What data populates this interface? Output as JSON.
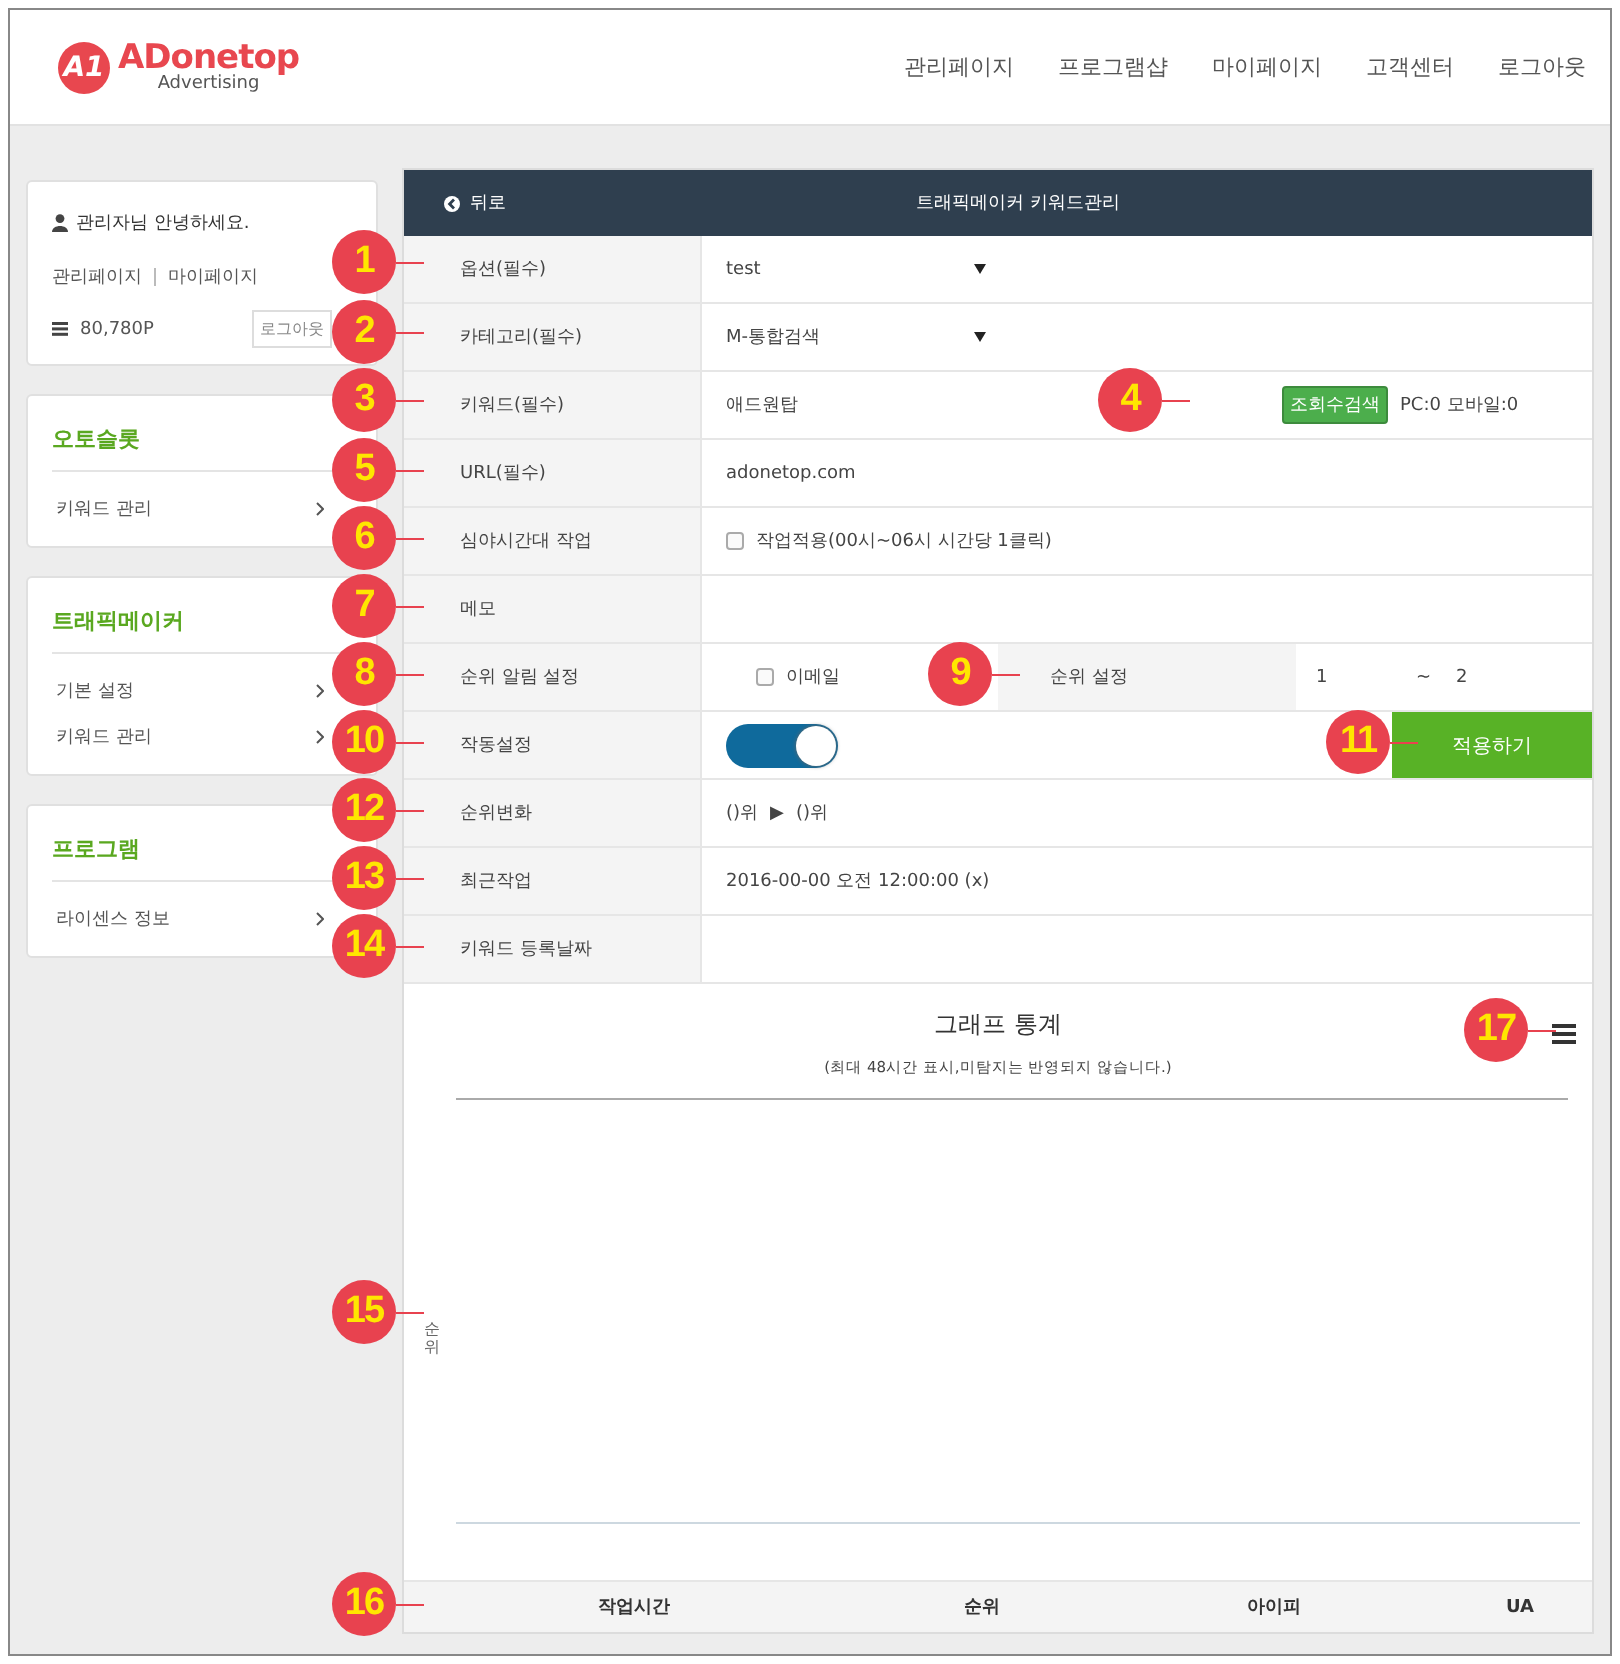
{
  "header": {
    "logo_mark": "A1",
    "logo_name": "ADonetop",
    "logo_sub": "Advertising",
    "nav": [
      "관리페이지",
      "프로그램샵",
      "마이페이지",
      "고객센터",
      "로그아웃"
    ]
  },
  "user_card": {
    "greeting": "관리자님 안녕하세요.",
    "links": [
      "관리페이지",
      "마이페이지"
    ],
    "points": "80,780P",
    "logout": "로그아웃"
  },
  "sidebar_sections": [
    {
      "title": "오토슬롯",
      "items": [
        "키워드 관리"
      ]
    },
    {
      "title": "트래픽메이커",
      "items": [
        "기본 설정",
        "키워드 관리"
      ]
    },
    {
      "title": "프로그램",
      "items": [
        "라이센스 정보"
      ]
    }
  ],
  "panel": {
    "back": "뒤로",
    "title": "트래픽메이커 키워드관리"
  },
  "rows": [
    {
      "kind": "select",
      "label": "옵션(필수)",
      "value": "test"
    },
    {
      "kind": "select",
      "label": "카테고리(필수)",
      "value": "M-통합검색"
    },
    {
      "kind": "keyword",
      "label": "키워드(필수)",
      "value": "애드원탑",
      "button": "조회수검색",
      "stats": "PC:0 모바일:0"
    },
    {
      "kind": "text",
      "label": "URL(필수)",
      "value": "adonetop.com"
    },
    {
      "kind": "checkbox",
      "label": "심야시간대 작업",
      "option": "작업적용(00시~06시 시간당 1클릭)",
      "checked": false
    },
    {
      "kind": "text",
      "label": "메모"
    },
    {
      "kind": "alert",
      "label": "순위 알림 설정",
      "option": "이메일",
      "checked": false,
      "range_label": "순위 설정",
      "from": "1",
      "tilde": "~",
      "to": "2"
    },
    {
      "kind": "toggle",
      "label": "작동설정",
      "on": true,
      "button": "적용하기"
    },
    {
      "kind": "rank",
      "label": "순위변화",
      "from": "()위",
      "arrow": "▶",
      "to": "()위"
    },
    {
      "kind": "text",
      "label": "최근작업",
      "value": "2016-00-00 오전 12:00:00 (x)"
    },
    {
      "kind": "text",
      "label": "키워드 등록날짜"
    }
  ],
  "chart": {
    "title": "그래프 통계",
    "subtitle": "(최대 48시간 표시,미탐지는 반영되지 않습니다.)",
    "ylabel": "순위"
  },
  "table": {
    "columns": [
      "작업시간",
      "순위",
      "아이피",
      "UA"
    ]
  },
  "callouts": [
    "1",
    "2",
    "3",
    "4",
    "5",
    "6",
    "7",
    "8",
    "9",
    "10",
    "11",
    "12",
    "13",
    "14",
    "15",
    "16",
    "17"
  ]
}
